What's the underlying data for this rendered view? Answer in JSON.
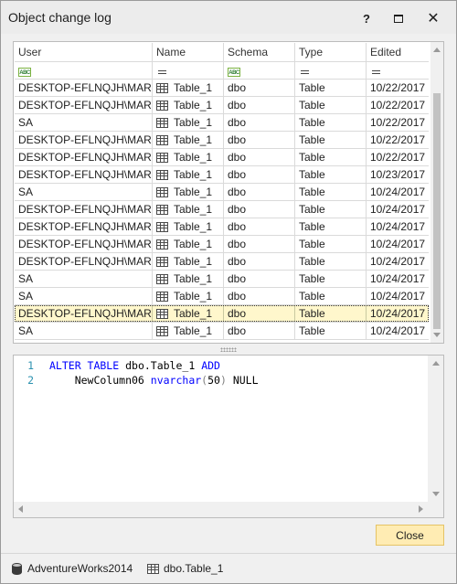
{
  "window": {
    "title": "Object change log",
    "help_glyph": "?",
    "close_glyph": "✕"
  },
  "grid": {
    "columns": [
      "User",
      "Name",
      "Schema",
      "Type",
      "Edited"
    ],
    "filter_icons": [
      "abc-filter-icon",
      "equals-filter-icon",
      "abc-filter-icon",
      "equals-filter-icon",
      "equals-filter-icon"
    ],
    "abc_text": "ABC",
    "rows": [
      {
        "user": "DESKTOP-EFLNQJH\\MARIJA",
        "name": "Table_1",
        "schema": "dbo",
        "type": "Table",
        "edited": "10/22/2017"
      },
      {
        "user": "DESKTOP-EFLNQJH\\MARIJA",
        "name": "Table_1",
        "schema": "dbo",
        "type": "Table",
        "edited": "10/22/2017"
      },
      {
        "user": "SA",
        "name": "Table_1",
        "schema": "dbo",
        "type": "Table",
        "edited": "10/22/2017"
      },
      {
        "user": "DESKTOP-EFLNQJH\\MARIJA",
        "name": "Table_1",
        "schema": "dbo",
        "type": "Table",
        "edited": "10/22/2017"
      },
      {
        "user": "DESKTOP-EFLNQJH\\MARIJA",
        "name": "Table_1",
        "schema": "dbo",
        "type": "Table",
        "edited": "10/22/2017"
      },
      {
        "user": "DESKTOP-EFLNQJH\\MARIJA",
        "name": "Table_1",
        "schema": "dbo",
        "type": "Table",
        "edited": "10/23/2017"
      },
      {
        "user": "SA",
        "name": "Table_1",
        "schema": "dbo",
        "type": "Table",
        "edited": "10/24/2017"
      },
      {
        "user": "DESKTOP-EFLNQJH\\MARIJA",
        "name": "Table_1",
        "schema": "dbo",
        "type": "Table",
        "edited": "10/24/2017"
      },
      {
        "user": "DESKTOP-EFLNQJH\\MARIJA",
        "name": "Table_1",
        "schema": "dbo",
        "type": "Table",
        "edited": "10/24/2017"
      },
      {
        "user": "DESKTOP-EFLNQJH\\MARIJA",
        "name": "Table_1",
        "schema": "dbo",
        "type": "Table",
        "edited": "10/24/2017"
      },
      {
        "user": "DESKTOP-EFLNQJH\\MARIJA",
        "name": "Table_1",
        "schema": "dbo",
        "type": "Table",
        "edited": "10/24/2017"
      },
      {
        "user": "SA",
        "name": "Table_1",
        "schema": "dbo",
        "type": "Table",
        "edited": "10/24/2017"
      },
      {
        "user": "SA",
        "name": "Table_1",
        "schema": "dbo",
        "type": "Table",
        "edited": "10/24/2017"
      },
      {
        "user": "DESKTOP-EFLNQJH\\MARIJA",
        "name": "Table_1",
        "schema": "dbo",
        "type": "Table",
        "edited": "10/24/2017",
        "selected": true
      },
      {
        "user": "SA",
        "name": "Table_1",
        "schema": "dbo",
        "type": "Table",
        "edited": "10/24/2017"
      }
    ]
  },
  "editor": {
    "lines": [
      {
        "number": "1",
        "tokens": [
          {
            "text": "ALTER TABLE",
            "kind": "kw"
          },
          {
            "text": " dbo.Table_1 ",
            "kind": "plain"
          },
          {
            "text": "ADD",
            "kind": "kw"
          }
        ]
      },
      {
        "number": "2",
        "tokens": [
          {
            "text": "    NewColumn06 ",
            "kind": "plain"
          },
          {
            "text": "nvarchar",
            "kind": "fn"
          },
          {
            "text": "(",
            "kind": "punct"
          },
          {
            "text": "50",
            "kind": "num"
          },
          {
            "text": ")",
            "kind": "punct"
          },
          {
            "text": " NULL",
            "kind": "plain"
          }
        ]
      }
    ]
  },
  "footer": {
    "close_label": "Close"
  },
  "status": {
    "database": "AdventureWorks2014",
    "object": "dbo.Table_1"
  },
  "colors": {
    "selected_row": "#fff7cc",
    "close_button": "#ffecb3",
    "keyword": "#0000ff",
    "line_number": "#2b91af"
  }
}
